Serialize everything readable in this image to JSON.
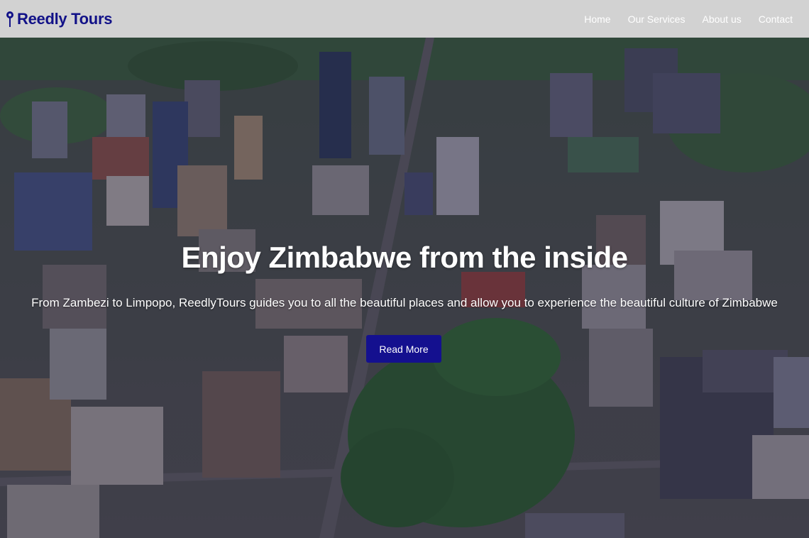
{
  "brand": {
    "name": "Reedly Tours",
    "icon": "map-pin-icon"
  },
  "nav": {
    "items": [
      {
        "label": "Home"
      },
      {
        "label": "Our Services"
      },
      {
        "label": "About us"
      },
      {
        "label": "Contact"
      }
    ]
  },
  "hero": {
    "title": "Enjoy Zimbabwe from the inside",
    "subtitle": "From Zambezi to Limpopo, ReedlyTours guides you to all the beautiful places and allow you to experience the beautiful culture of Zimbabwe",
    "button_label": "Read More",
    "background": "aerial-city-photo"
  },
  "colors": {
    "navbar_bg": "#d2d2d2",
    "brand": "#121288",
    "button_bg": "#14108f",
    "text_light": "#ffffff"
  }
}
